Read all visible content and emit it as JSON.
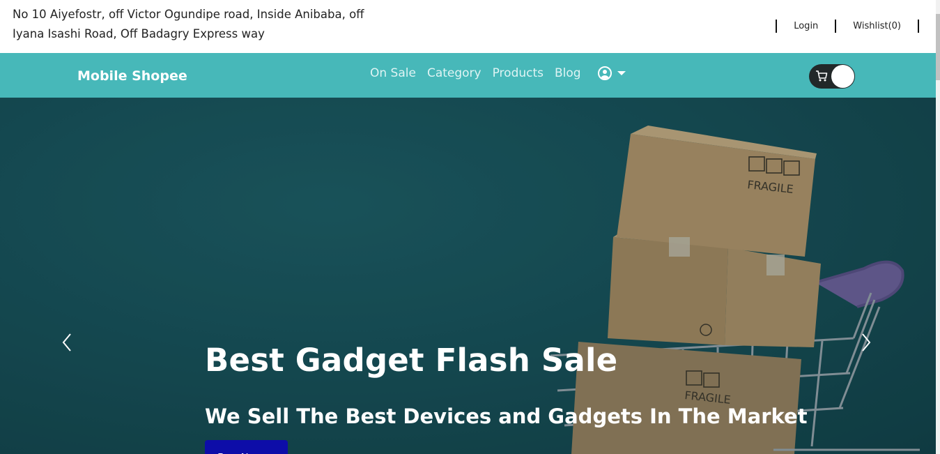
{
  "topbar": {
    "address": "No 10 Aiyefostr, off Victor Ogundipe road, Inside Anibaba, off Iyana Isashi Road, Off Badagry Express way",
    "login_label": "Login",
    "wishlist_label": "Wishlist(0)"
  },
  "navbar": {
    "brand": "Mobile Shopee",
    "links": [
      {
        "label": "On Sale"
      },
      {
        "label": "Category"
      },
      {
        "label": "Products"
      },
      {
        "label": "Blog"
      }
    ],
    "user_icon": "user-circle-icon",
    "cart_icon": "shopping-cart-icon",
    "color": "#47b8b9"
  },
  "hero": {
    "title": "Best Gadget Flash Sale",
    "subtitle": "We Sell The Best Devices and Gadgets In The Market",
    "button_label": "Buy Now",
    "prev_icon": "chevron-left-icon",
    "next_icon": "chevron-right-icon",
    "background_color": "#174e56",
    "button_color": "#0d0da8",
    "box_label": "FRAGILE"
  }
}
